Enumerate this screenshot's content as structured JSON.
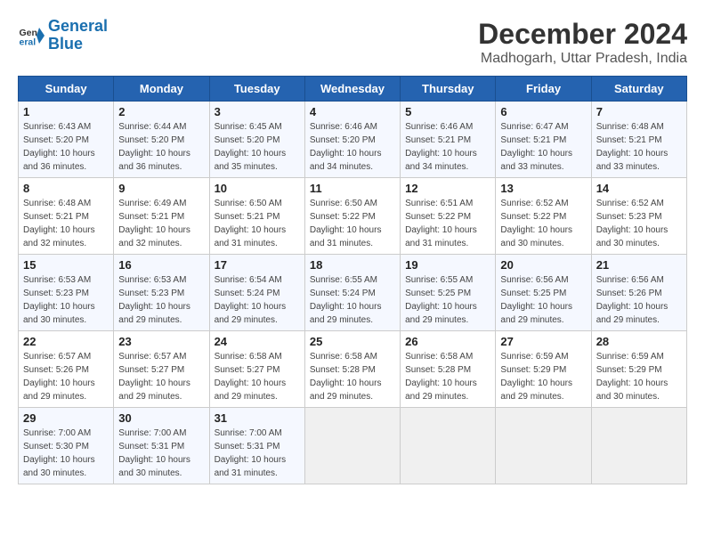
{
  "logo": {
    "line1": "General",
    "line2": "Blue"
  },
  "title": "December 2024",
  "subtitle": "Madhogarh, Uttar Pradesh, India",
  "days_of_week": [
    "Sunday",
    "Monday",
    "Tuesday",
    "Wednesday",
    "Thursday",
    "Friday",
    "Saturday"
  ],
  "weeks": [
    [
      {
        "day": "1",
        "info": "Sunrise: 6:43 AM\nSunset: 5:20 PM\nDaylight: 10 hours\nand 36 minutes."
      },
      {
        "day": "2",
        "info": "Sunrise: 6:44 AM\nSunset: 5:20 PM\nDaylight: 10 hours\nand 36 minutes."
      },
      {
        "day": "3",
        "info": "Sunrise: 6:45 AM\nSunset: 5:20 PM\nDaylight: 10 hours\nand 35 minutes."
      },
      {
        "day": "4",
        "info": "Sunrise: 6:46 AM\nSunset: 5:20 PM\nDaylight: 10 hours\nand 34 minutes."
      },
      {
        "day": "5",
        "info": "Sunrise: 6:46 AM\nSunset: 5:21 PM\nDaylight: 10 hours\nand 34 minutes."
      },
      {
        "day": "6",
        "info": "Sunrise: 6:47 AM\nSunset: 5:21 PM\nDaylight: 10 hours\nand 33 minutes."
      },
      {
        "day": "7",
        "info": "Sunrise: 6:48 AM\nSunset: 5:21 PM\nDaylight: 10 hours\nand 33 minutes."
      }
    ],
    [
      {
        "day": "8",
        "info": "Sunrise: 6:48 AM\nSunset: 5:21 PM\nDaylight: 10 hours\nand 32 minutes."
      },
      {
        "day": "9",
        "info": "Sunrise: 6:49 AM\nSunset: 5:21 PM\nDaylight: 10 hours\nand 32 minutes."
      },
      {
        "day": "10",
        "info": "Sunrise: 6:50 AM\nSunset: 5:21 PM\nDaylight: 10 hours\nand 31 minutes."
      },
      {
        "day": "11",
        "info": "Sunrise: 6:50 AM\nSunset: 5:22 PM\nDaylight: 10 hours\nand 31 minutes."
      },
      {
        "day": "12",
        "info": "Sunrise: 6:51 AM\nSunset: 5:22 PM\nDaylight: 10 hours\nand 31 minutes."
      },
      {
        "day": "13",
        "info": "Sunrise: 6:52 AM\nSunset: 5:22 PM\nDaylight: 10 hours\nand 30 minutes."
      },
      {
        "day": "14",
        "info": "Sunrise: 6:52 AM\nSunset: 5:23 PM\nDaylight: 10 hours\nand 30 minutes."
      }
    ],
    [
      {
        "day": "15",
        "info": "Sunrise: 6:53 AM\nSunset: 5:23 PM\nDaylight: 10 hours\nand 30 minutes."
      },
      {
        "day": "16",
        "info": "Sunrise: 6:53 AM\nSunset: 5:23 PM\nDaylight: 10 hours\nand 29 minutes."
      },
      {
        "day": "17",
        "info": "Sunrise: 6:54 AM\nSunset: 5:24 PM\nDaylight: 10 hours\nand 29 minutes."
      },
      {
        "day": "18",
        "info": "Sunrise: 6:55 AM\nSunset: 5:24 PM\nDaylight: 10 hours\nand 29 minutes."
      },
      {
        "day": "19",
        "info": "Sunrise: 6:55 AM\nSunset: 5:25 PM\nDaylight: 10 hours\nand 29 minutes."
      },
      {
        "day": "20",
        "info": "Sunrise: 6:56 AM\nSunset: 5:25 PM\nDaylight: 10 hours\nand 29 minutes."
      },
      {
        "day": "21",
        "info": "Sunrise: 6:56 AM\nSunset: 5:26 PM\nDaylight: 10 hours\nand 29 minutes."
      }
    ],
    [
      {
        "day": "22",
        "info": "Sunrise: 6:57 AM\nSunset: 5:26 PM\nDaylight: 10 hours\nand 29 minutes."
      },
      {
        "day": "23",
        "info": "Sunrise: 6:57 AM\nSunset: 5:27 PM\nDaylight: 10 hours\nand 29 minutes."
      },
      {
        "day": "24",
        "info": "Sunrise: 6:58 AM\nSunset: 5:27 PM\nDaylight: 10 hours\nand 29 minutes."
      },
      {
        "day": "25",
        "info": "Sunrise: 6:58 AM\nSunset: 5:28 PM\nDaylight: 10 hours\nand 29 minutes."
      },
      {
        "day": "26",
        "info": "Sunrise: 6:58 AM\nSunset: 5:28 PM\nDaylight: 10 hours\nand 29 minutes."
      },
      {
        "day": "27",
        "info": "Sunrise: 6:59 AM\nSunset: 5:29 PM\nDaylight: 10 hours\nand 29 minutes."
      },
      {
        "day": "28",
        "info": "Sunrise: 6:59 AM\nSunset: 5:29 PM\nDaylight: 10 hours\nand 30 minutes."
      }
    ],
    [
      {
        "day": "29",
        "info": "Sunrise: 7:00 AM\nSunset: 5:30 PM\nDaylight: 10 hours\nand 30 minutes."
      },
      {
        "day": "30",
        "info": "Sunrise: 7:00 AM\nSunset: 5:31 PM\nDaylight: 10 hours\nand 30 minutes."
      },
      {
        "day": "31",
        "info": "Sunrise: 7:00 AM\nSunset: 5:31 PM\nDaylight: 10 hours\nand 31 minutes."
      },
      {
        "day": "",
        "info": ""
      },
      {
        "day": "",
        "info": ""
      },
      {
        "day": "",
        "info": ""
      },
      {
        "day": "",
        "info": ""
      }
    ]
  ]
}
